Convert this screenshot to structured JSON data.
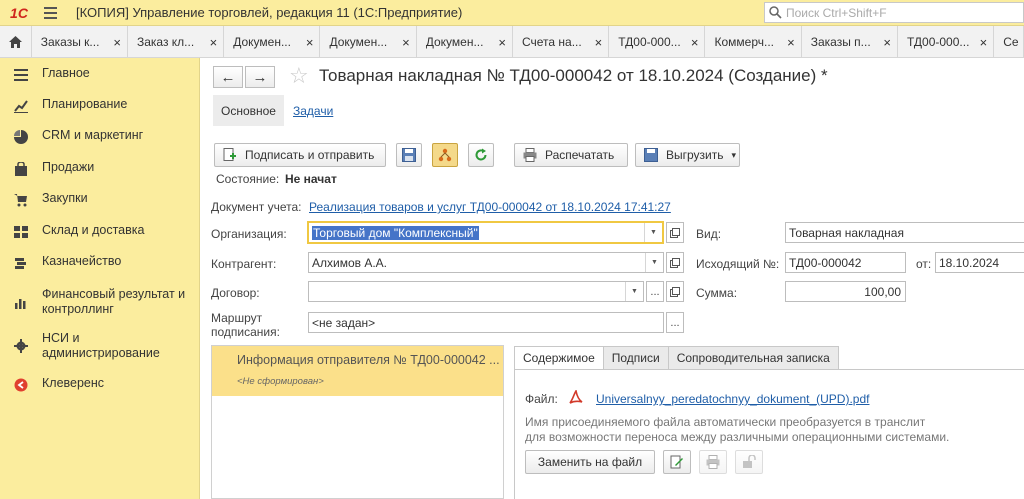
{
  "app": {
    "logo": "1С",
    "title": "[КОПИЯ] Управление торговлей, редакция 11  (1С:Предприятие)",
    "search_placeholder": "Поиск Ctrl+Shift+F"
  },
  "tabs": [
    {
      "label": "Заказы к..."
    },
    {
      "label": "Заказ кл..."
    },
    {
      "label": "Докумен..."
    },
    {
      "label": "Докумен..."
    },
    {
      "label": "Докумен..."
    },
    {
      "label": "Счета на..."
    },
    {
      "label": "ТД00-000..."
    },
    {
      "label": "Коммерч..."
    },
    {
      "label": "Заказы п..."
    },
    {
      "label": "ТД00-000..."
    },
    {
      "label": "Се"
    }
  ],
  "tab_close": "×",
  "sidebar": {
    "items": [
      {
        "label": "Главное"
      },
      {
        "label": "Планирование"
      },
      {
        "label": "CRM и маркетинг"
      },
      {
        "label": "Продажи"
      },
      {
        "label": "Закупки"
      },
      {
        "label": "Склад и доставка"
      },
      {
        "label": "Казначейство"
      },
      {
        "label": "Финансовый результат и контроллинг"
      },
      {
        "label": "НСИ и администрирование"
      },
      {
        "label": "Клеверенс"
      }
    ]
  },
  "document": {
    "back": "←",
    "forward": "→",
    "star": "☆",
    "title": "Товарная накладная № ТД00-000042 от 18.10.2024 (Создание) *",
    "subtabs": {
      "main": "Основное",
      "tasks": "Задачи"
    }
  },
  "toolbar": {
    "sign_send": "Подписать и отправить",
    "print": "Распечатать",
    "export": "Выгрузить",
    "export_arrow": "▾"
  },
  "state": {
    "label": "Состояние:",
    "value": "Не начат"
  },
  "form": {
    "doc_label": "Документ учета:",
    "doc_link": "Реализация товаров и услуг ТД00-000042 от 18.10.2024 17:41:27",
    "org_label": "Организация:",
    "org_value": "Торговый дом \"Комплексный\"",
    "contractor_label": "Контрагент:",
    "contractor_value": "Алхимов А.А.",
    "contract_label": "Договор:",
    "contract_value": "",
    "route_label_1": "Маршрут",
    "route_label_2": "подписания:",
    "route_value": "<не задан>",
    "kind_label": "Вид:",
    "kind_value": "Товарная накладная",
    "outgoing_label": "Исходящий №:",
    "outgoing_value": "ТД00-000042",
    "from_label": "от:",
    "from_value": "18.10.2024",
    "sum_label": "Сумма:",
    "sum_value": "100,00",
    "dots": "...",
    "arrow": "▼"
  },
  "left_panel": {
    "title": "Информация отправителя № ТД00-000042 ...",
    "subtitle": "<Не сформирован>"
  },
  "right_tabs": [
    "Содержимое",
    "Подписи",
    "Сопроводительная записка"
  ],
  "content": {
    "file_label": "Файл:",
    "file_name": "Universalnyy_peredatochnyy_dokument_(UPD).pdf",
    "hint_1": "Имя присоединяемого файла автоматически преобразуется в транслит",
    "hint_2": "для возможности переноса между различными операционными системами.",
    "replace_btn": "Заменить на файл"
  },
  "colors": {
    "accent_yellow": "#fbed9e",
    "selection": "#4574c8",
    "link": "#1f5ea8",
    "brand_red": "#d0271d"
  }
}
